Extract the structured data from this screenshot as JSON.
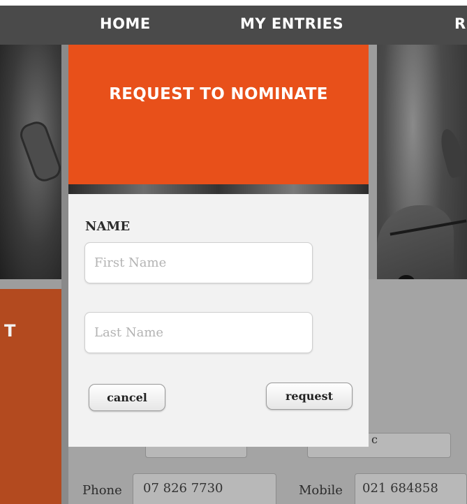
{
  "nav": {
    "items": [
      "HOME",
      "MY ENTRIES",
      "R"
    ]
  },
  "left_panel": {
    "letter": "T"
  },
  "modal": {
    "title": "REQUEST TO NOMINATE",
    "name_label": "NAME",
    "first_name_placeholder": "First Name",
    "last_name_placeholder": "Last Name",
    "cancel_label": "cancel",
    "request_label": "request"
  },
  "background_form": {
    "phone_label": "Phone",
    "phone_value": "07 826 7730",
    "mobile_label": "Mobile",
    "mobile_value": "021 684858",
    "partial_char": "c"
  },
  "colors": {
    "nav_bg": "#4a4a4a",
    "modal_header": "#e8501a",
    "left_panel": "#b34a1f",
    "modal_body": "#f2f2f2"
  }
}
